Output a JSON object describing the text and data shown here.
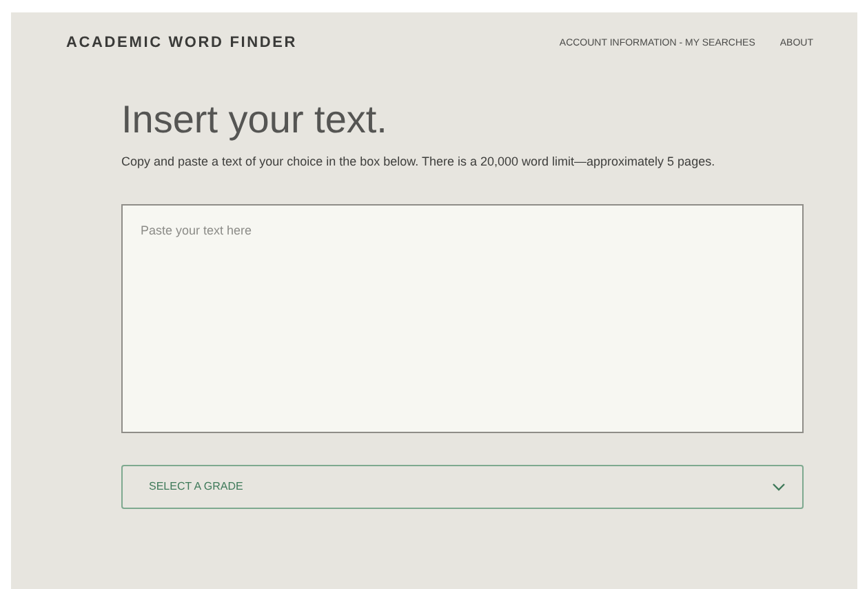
{
  "header": {
    "logo": "ACADEMIC WORD FINDER",
    "nav": [
      "ACCOUNT INFORMATION - MY SEARCHES",
      "ABOUT"
    ]
  },
  "heading": "Insert your text.",
  "intro": "Copy and paste a text of your choice in the box below. There is a 20,000 word limit—approximately 5 pages.",
  "text_box": {
    "placeholder": "Paste your text here"
  },
  "grade_select": {
    "label": "SELECT A GRADE"
  }
}
